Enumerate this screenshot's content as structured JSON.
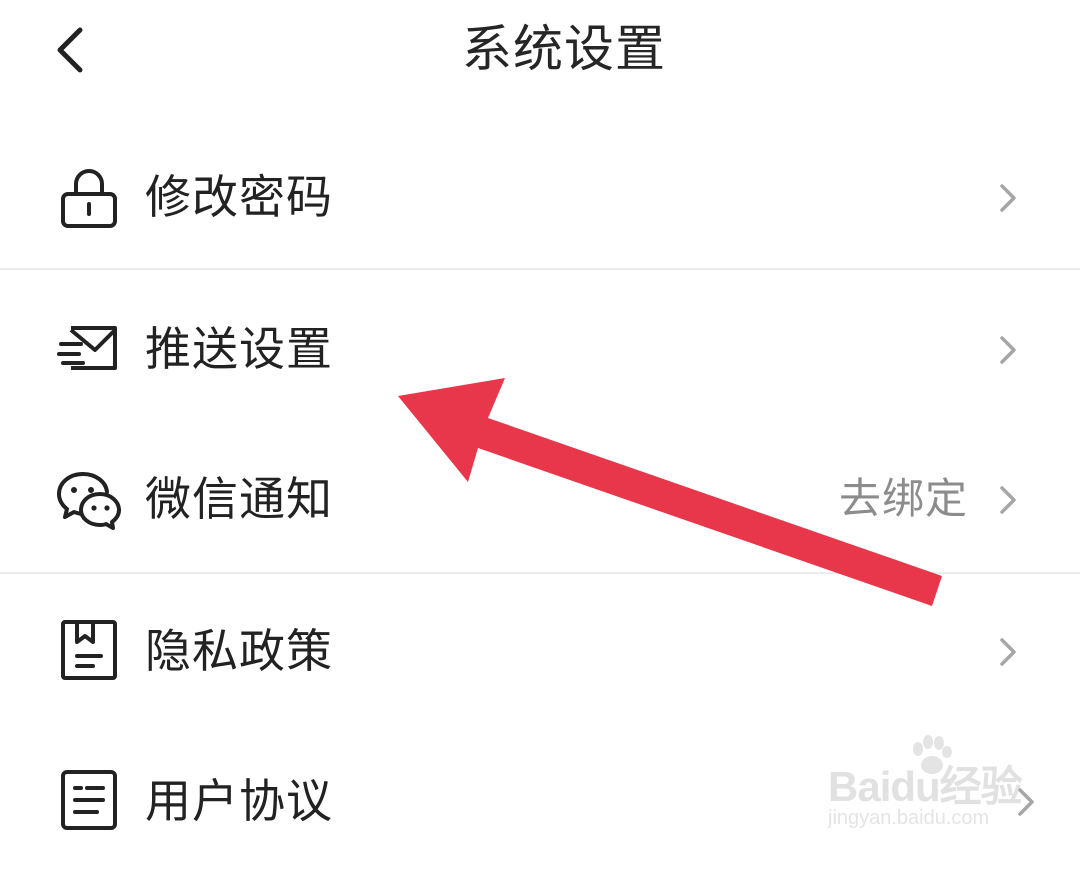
{
  "header": {
    "title": "系统设置",
    "back_icon": "chevron-left-icon"
  },
  "menu": {
    "items": [
      {
        "id": "change-password",
        "icon": "lock-icon",
        "label": "修改密码",
        "value": ""
      },
      {
        "id": "push-settings",
        "icon": "mail-icon",
        "label": "推送设置",
        "value": ""
      },
      {
        "id": "wechat-notify",
        "icon": "wechat-icon",
        "label": "微信通知",
        "value": "去绑定"
      },
      {
        "id": "privacy-policy",
        "icon": "document-icon",
        "label": "隐私政策",
        "value": ""
      },
      {
        "id": "user-agreement",
        "icon": "list-icon",
        "label": "用户协议",
        "value": ""
      }
    ]
  },
  "annotation": {
    "arrow_color": "#e8364a"
  },
  "watermark": {
    "brand": "Baidu经验",
    "url": "jingyan.baidu.com"
  }
}
